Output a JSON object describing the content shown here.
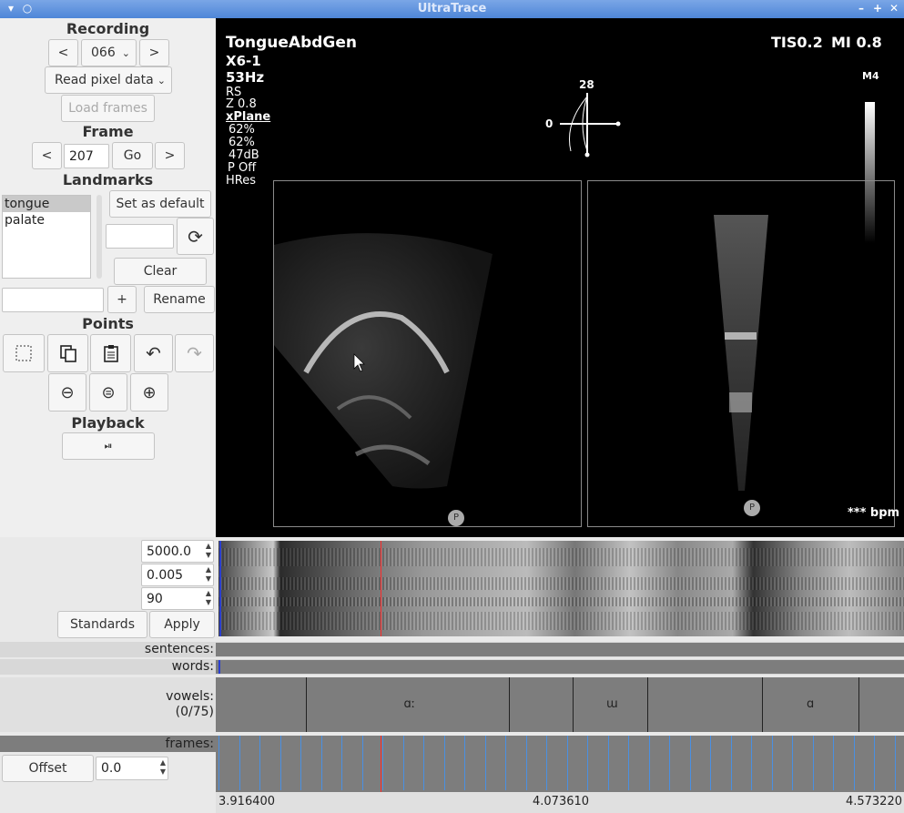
{
  "window": {
    "title": "UltraTrace"
  },
  "recording": {
    "heading": "Recording",
    "prev": "<",
    "value": "066",
    "next": ">",
    "source": "Read pixel data",
    "load": "Load frames"
  },
  "frame": {
    "heading": "Frame",
    "prev": "<",
    "value": "207",
    "go": "Go",
    "next": ">"
  },
  "landmarks": {
    "heading": "Landmarks",
    "items": [
      "tongue",
      "palate"
    ],
    "selected": "tongue",
    "set_default": "Set as default",
    "clear": "Clear",
    "plus": "+",
    "rename": "Rename"
  },
  "points": {
    "heading": "Points"
  },
  "playback": {
    "heading": "Playback",
    "play_pause": "⏯"
  },
  "ultrasound": {
    "preset": "TongueAbdGen",
    "probe": "X6-1",
    "rate": "53Hz",
    "rs": "RS",
    "zoom": "Z 0.8",
    "mode": "xPlane",
    "gain1": "62%",
    "gain2": "62%",
    "db": "47dB",
    "p": "P Off",
    "res": "HRes",
    "tis": "TIS0.2",
    "mi": "MI 0.8",
    "map": "M4",
    "angle_top": "28",
    "angle_left": "0",
    "bpm": "*** bpm",
    "p_marker": "P"
  },
  "spectrogram": {
    "max_freq": "5000.0",
    "window": "0.005",
    "dynamic_range": "90",
    "standards": "Standards",
    "apply": "Apply"
  },
  "tiers": {
    "sentences": "sentences:",
    "words": "words:",
    "vowels": "vowels:",
    "vowels_count": "(0/75)",
    "frames": "frames:",
    "vowel_segments": [
      {
        "label": "",
        "start": 0
      },
      {
        "label": "ɑː",
        "start": 99
      },
      {
        "label": "",
        "start": 322
      },
      {
        "label": "ɯ",
        "start": 392
      },
      {
        "label": "",
        "start": 474
      },
      {
        "label": "ɑ",
        "start": 600
      },
      {
        "label": "",
        "start": 706
      }
    ]
  },
  "offset": {
    "label": "Offset",
    "value": "0.0"
  },
  "timeline": {
    "start": "3.916400",
    "cursor": "4.073610",
    "end": "4.573220"
  },
  "colors": {
    "cursor": "#ff2b2b",
    "frame_tick": "#4a90e2",
    "titlebar": "#5a8fdc"
  }
}
